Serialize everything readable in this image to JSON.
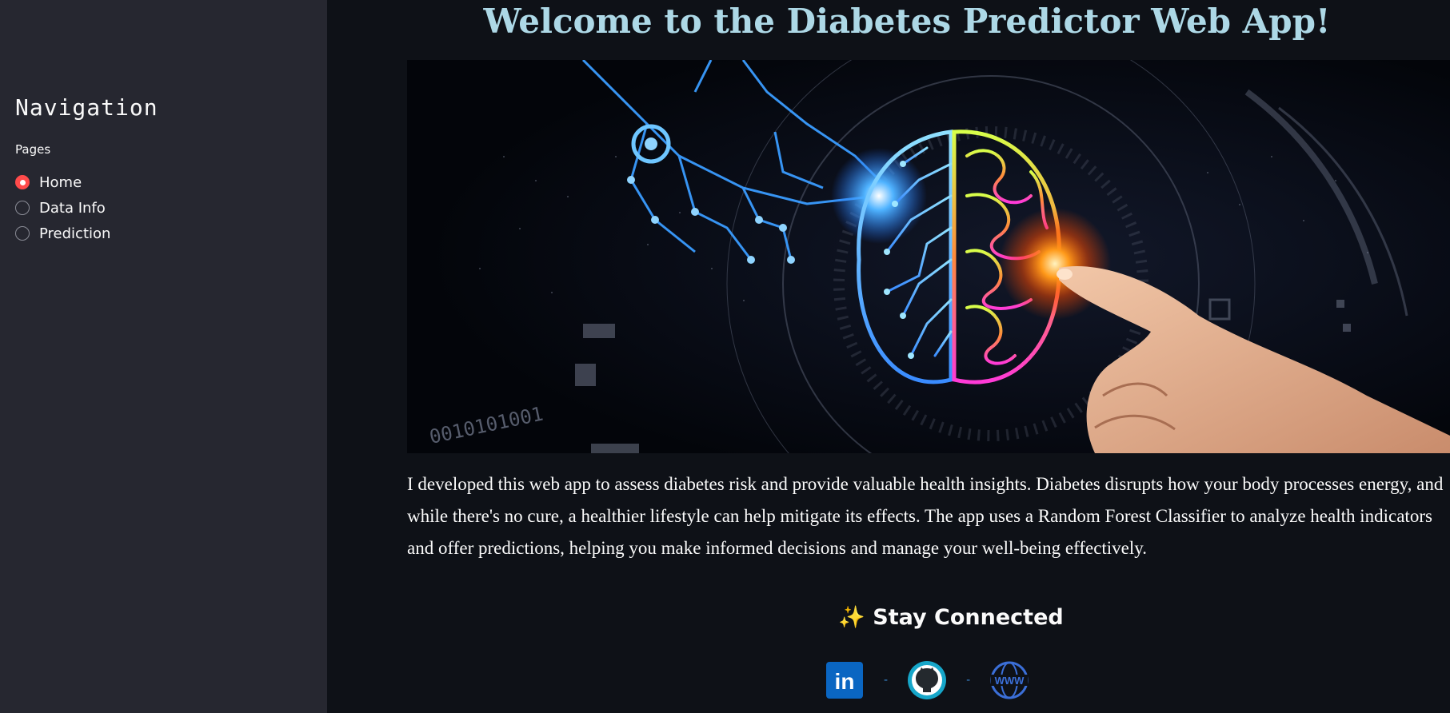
{
  "sidebar": {
    "title": "Navigation",
    "pages_label": "Pages",
    "items": [
      {
        "label": "Home",
        "selected": true
      },
      {
        "label": "Data Info",
        "selected": false
      },
      {
        "label": "Prediction",
        "selected": false
      }
    ]
  },
  "main": {
    "title": "Welcome to the Diabetes Predictor Web App!",
    "hero": {
      "binary_text": "0010101001"
    },
    "description": "I developed this web app to assess diabetes risk and provide valuable health insights. Diabetes disrupts how your body processes energy, and while there's no cure, a healthier lifestyle can help mitigate its effects. The app uses a Random Forest Classifier to analyze health indicators and offer predictions, helping you make informed decisions and manage your well-being effectively.",
    "connect_heading": "✨ Stay Connected",
    "socials": [
      {
        "icon": "linkedin-icon",
        "text": "in"
      },
      {
        "separator": "-"
      },
      {
        "icon": "github-icon"
      },
      {
        "separator": "-"
      },
      {
        "icon": "website-icon",
        "text": "WWW"
      }
    ]
  },
  "colors": {
    "background": "#0e1117",
    "sidebar": "#262730",
    "accent": "#ff4b4b",
    "title": "#add8e6",
    "linkedin": "#0a66c2"
  }
}
